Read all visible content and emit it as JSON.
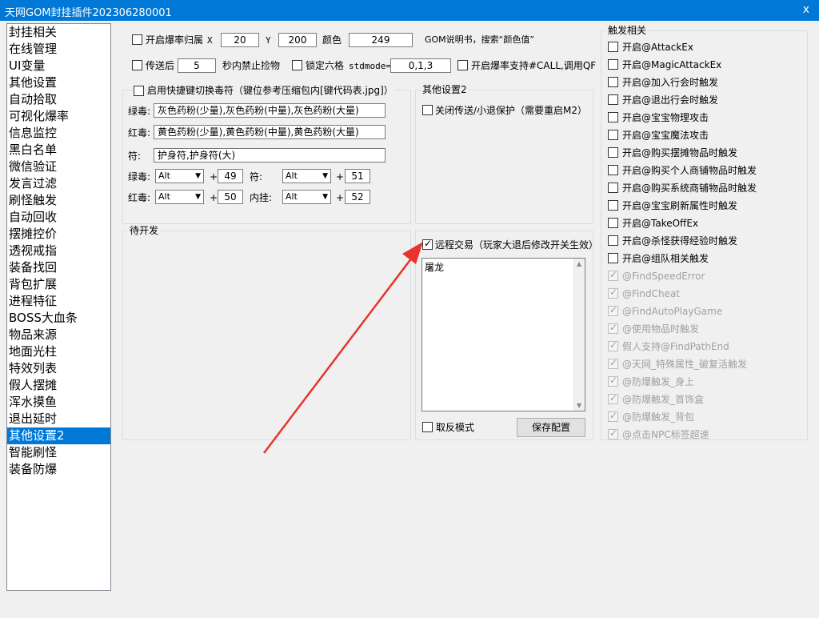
{
  "window": {
    "title": "天网GOM封挂插件202306280001",
    "close_glyph": "x"
  },
  "sidebar": {
    "items": [
      "封挂相关",
      "在线管理",
      "UI变量",
      "其他设置",
      "自动拾取",
      "可视化爆率",
      "信息监控",
      "黑白名单",
      "微信验证",
      "发言过滤",
      "刷怪触发",
      "自动回收",
      "摆摊控价",
      "透视戒指",
      "装备找回",
      "背包扩展",
      "进程特征",
      "BOSS大血条",
      "物品来源",
      "地面光柱",
      "特效列表",
      "假人摆摊",
      "浑水摸鱼",
      "退出延时",
      "其他设置2",
      "智能刷怪",
      "装备防爆"
    ],
    "selected_index": 24
  },
  "top": {
    "drop_label": "开启爆率归属",
    "x_label": "X",
    "x_value": "20",
    "y_label": "Y",
    "y_value": "200",
    "color_label": "颜色",
    "color_value": "249",
    "gom_hint": "GOM说明书，搜索“颜色值”",
    "teleport_label": "传送后",
    "teleport_value": "5",
    "teleport_suffix": "秒内禁止捡物",
    "lock_label": "锁定六格",
    "stdmode_label": "stdmode=",
    "stdmode_value": "0,1,3",
    "callqf_label": "开启爆率支持#CALL,调用QF"
  },
  "hotkey": {
    "title": "启用快捷键切换毒符（键位参考压缩包内[键代码表.jpg]）",
    "green_label": "绿毒:",
    "green_value": "灰色药粉(少量),灰色药粉(中量),灰色药粉(大量)",
    "red_label": "红毒:",
    "red_value": "黄色药粉(少量),黄色药粉(中量),黄色药粉(大量)",
    "talisman_label": "符:",
    "talisman_value": "护身符,护身符(大)",
    "row1": {
      "label1": "绿毒:",
      "key1": "Alt",
      "plus": "+",
      "val1": "49",
      "label2": "符:",
      "key2": "Alt",
      "val2": "51"
    },
    "row2": {
      "label1": "红毒:",
      "key1": "Alt",
      "plus": "+",
      "val1": "50",
      "label2": "内挂:",
      "key2": "Alt",
      "val2": "52"
    }
  },
  "other2": {
    "title": "其他设置2",
    "close_protect": "关闭传送/小退保护（需要重启M2）"
  },
  "pending": {
    "title": "待开发"
  },
  "remote": {
    "checkbox_label": "远程交易（玩家大退后修改开关生效）",
    "list_text": "屠龙",
    "invert_label": "取反模式",
    "save_button": "保存配置"
  },
  "triggers": {
    "title": "触发相关",
    "items": [
      "开启@AttackEx",
      "开启@MagicAttackEx",
      "开启@加入行会时触发",
      "开启@退出行会时触发",
      "开启@宝宝物理攻击",
      "开启@宝宝魔法攻击",
      "开启@购买摆摊物品时触发",
      "开启@购买个人商铺物品时触发",
      "开启@购买系统商铺物品时触发",
      "开启@宝宝刷新属性时触发",
      "开启@TakeOffEx",
      "开启@杀怪获得经验时触发",
      "开启@组队相关触发"
    ],
    "disabled_items": [
      "@FindSpeedError",
      "@FindCheat",
      "@FindAutoPlayGame",
      "@使用物品时触发",
      "假人支持@FindPathEnd",
      "@天网_特殊属性_破复活触发",
      "@防爆触发_身上",
      "@防爆触发_首饰盒",
      "@防爆触发_背包",
      "@点击NPC标签超速"
    ]
  },
  "colors": {
    "accent": "#0078d7",
    "arrow": "#e8342c"
  }
}
